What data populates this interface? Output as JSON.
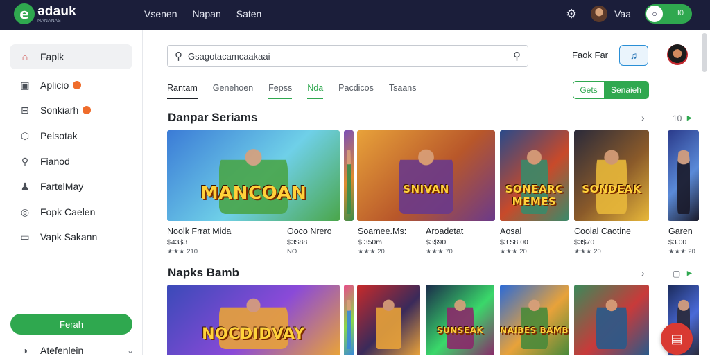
{
  "brand": {
    "title": "ədauk",
    "subtitle": "NANANAS",
    "icon": "logo-e-icon"
  },
  "top_nav": [
    "Vsenen",
    "Napan",
    "Saten"
  ],
  "top_user": {
    "name": "Vaa",
    "toggle_label": "I0"
  },
  "sidebar": {
    "items": [
      {
        "label": "Faplk",
        "icon": "home-icon",
        "active": true,
        "badge": false
      },
      {
        "label": "Aplicio",
        "icon": "inbox-icon",
        "active": false,
        "badge": true
      },
      {
        "label": "Sonkiarh",
        "icon": "package-icon",
        "active": false,
        "badge": true
      },
      {
        "label": "Pelsotak",
        "icon": "box-icon",
        "active": false,
        "badge": false
      },
      {
        "label": "Fianod",
        "icon": "search-icon",
        "active": false,
        "badge": false
      },
      {
        "label": "FartelMay",
        "icon": "person-icon",
        "active": false,
        "badge": false
      },
      {
        "label": "Fopk Caelen",
        "icon": "settings-icon",
        "active": false,
        "badge": false
      },
      {
        "label": "Vapk Sakann",
        "icon": "window-icon",
        "active": false,
        "badge": false
      }
    ],
    "button_label": "Ferah",
    "footer_label": "Atefenlein"
  },
  "search": {
    "value": "Gsagotacamcaakaai"
  },
  "header_link": "Faok Far",
  "tabs": [
    {
      "label": "Rantam",
      "state": "first"
    },
    {
      "label": "Genehoen",
      "state": "normal"
    },
    {
      "label": "Fepss",
      "state": "underline"
    },
    {
      "label": "Nda",
      "state": "active"
    },
    {
      "label": "Pacdicos",
      "state": "normal"
    },
    {
      "label": "Tsaans",
      "state": "normal"
    }
  ],
  "segmented": {
    "left": "Gets",
    "right": "Senaieh"
  },
  "section1": {
    "title": "Danpar Seriams",
    "arrow2_label": "10",
    "cards": [
      {
        "title": "Noolk Frrat Mida",
        "price": "$43$3",
        "rating": "★★★ 210",
        "art_word": "MANCOAN",
        "palette": [
          "#3b7bd6",
          "#6fd0e8",
          "#4aa64a"
        ]
      },
      {
        "title": "Ooco Nrero",
        "price": "$3$88",
        "rating": "NO",
        "art_word": "",
        "palette": [
          "#7a4fb8",
          "#e08b2f",
          "#3a8d4a"
        ]
      },
      {
        "title": "Soamee.Ms:",
        "price": "$ 350m",
        "rating": "★★★ 20",
        "art_word": "SNIVAN",
        "palette": [
          "#e8a23a",
          "#b8572a",
          "#6b3a8a"
        ]
      },
      {
        "title": "Aroadetat",
        "price": "$3$90",
        "rating": "★★★ 70",
        "art_word": "",
        "palette": [
          "#c8933a",
          "#7a3a2a",
          "#2a6b8a"
        ]
      },
      {
        "title": "Aosal",
        "price": "$3 $8.00",
        "rating": "★★★ 20",
        "art_word": "SONEARC MEMES",
        "palette": [
          "#2a4a8a",
          "#c84a2a",
          "#3a8a6a"
        ]
      },
      {
        "title": "Cooial Caotine",
        "price": "$3$70",
        "rating": "★★★ 20",
        "art_word": "SONDEAK",
        "palette": [
          "#2a2a3a",
          "#8a5a2a",
          "#e8b83a"
        ]
      },
      {
        "title": "Garen",
        "price": "$3.00",
        "rating": "★★★ 20",
        "art_word": "",
        "palette": [
          "#2a3a8a",
          "#5a8ad8",
          "#1a1a2a"
        ]
      }
    ]
  },
  "section2": {
    "title": "Napks Bamb",
    "cards": [
      {
        "palette": [
          "#3a4ab8",
          "#8a4ad8",
          "#e8a23a"
        ],
        "art_word": "NOCDIDVAY"
      },
      {
        "palette": [
          "#e84a8a",
          "#8ad84a",
          "#3a8ad8"
        ],
        "art_word": ""
      },
      {
        "palette": [
          "#c82a2a",
          "#3a2a5a",
          "#e8a23a"
        ],
        "art_word": ""
      },
      {
        "palette": [
          "#1a2a4a",
          "#3ad86a",
          "#8a2a6a"
        ],
        "art_word": "SUNSEAK"
      },
      {
        "palette": [
          "#2a6ad8",
          "#e8a23a",
          "#4a8a3a"
        ],
        "art_word": "NAIBES BAMB"
      },
      {
        "palette": [
          "#3a8a5a",
          "#c83a3a",
          "#2a5a8a"
        ],
        "art_word": ""
      },
      {
        "palette": [
          "#1a2a5a",
          "#4a6ad8",
          "#2a2a3a"
        ],
        "art_word": ""
      }
    ]
  },
  "fab_icon": "cart-icon",
  "accent": "#2fa84f",
  "topbar_color": "#1b1e3a"
}
